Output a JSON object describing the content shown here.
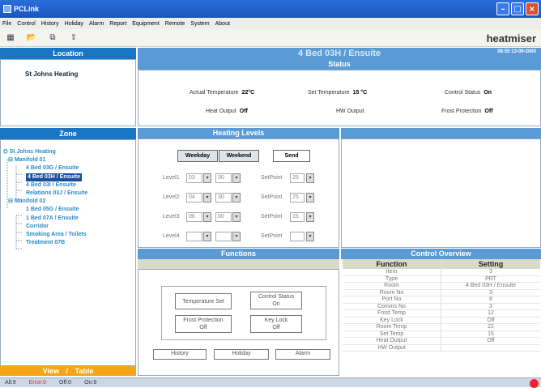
{
  "window": {
    "title": "PCLink"
  },
  "menu": [
    "File",
    "Control",
    "History",
    "Holiday",
    "Alarm",
    "Report",
    "Equipment",
    "Remote",
    "System",
    "About"
  ],
  "logo": "heatmiser",
  "location": {
    "header": "Location",
    "item": "St Johns Heating"
  },
  "zone": {
    "header": "Zone",
    "tree": [
      {
        "label": "St Johns Heating",
        "level": 0
      },
      {
        "label": "Manifold 01",
        "level": 1
      },
      {
        "label": "4 Bed 03G / Ensuite",
        "level": 2
      },
      {
        "label": "4 Bed 03H / Ensuite",
        "level": 2,
        "selected": true
      },
      {
        "label": "4 Bed 03I / Ensuite",
        "level": 2
      },
      {
        "label": "Relations 03J / Ensuite",
        "level": 2
      },
      {
        "label": "Manifold 02",
        "level": 1
      },
      {
        "label": "1 Bed 05G / Ensuite",
        "level": 2
      },
      {
        "label": "1 Bed 07A / Ensuite",
        "level": 2
      },
      {
        "label": "Corridor",
        "level": 2
      },
      {
        "label": "Smoking Area / Toilets",
        "level": 2
      },
      {
        "label": "Treatment 07B",
        "level": 2
      }
    ]
  },
  "viewtab": {
    "view": "View",
    "sep": "/",
    "table": "Table"
  },
  "main": {
    "room_title": "4 Bed 03H / Ensuite",
    "datetime": "08:55 13-09-2005",
    "status_header": "Status"
  },
  "status": {
    "actual_temp_label": "Actual Temperature",
    "actual_temp_value": "22°C",
    "set_temp_label": "Set Temperature",
    "set_temp_value": "15 °C",
    "control_status_label": "Control Status",
    "control_status_value": "On",
    "heat_output_label": "Heat Output",
    "heat_output_value": "Off",
    "hw_output_label": "HW Output",
    "hw_output_value": "",
    "frost_label": "Frost Protection",
    "frost_value": "Off"
  },
  "heating": {
    "header": "Heating Levels",
    "weekday": "Weekday",
    "weekend": "Weekend",
    "send": "Send",
    "levels": [
      {
        "label": "Level1",
        "hour": "03",
        "min": "30",
        "setpoint_label": "SetPoint",
        "setpoint": "25"
      },
      {
        "label": "Level2",
        "hour": "04",
        "min": "30",
        "setpoint_label": "SetPoint",
        "setpoint": "25"
      },
      {
        "label": "Level3",
        "hour": "06",
        "min": "00",
        "setpoint_label": "SetPoint",
        "setpoint": "15"
      },
      {
        "label": "Level4",
        "hour": "",
        "min": "",
        "setpoint_label": "SetPoint",
        "setpoint": ""
      }
    ]
  },
  "functions": {
    "header": "Functions",
    "temp_set": "Temperature Set",
    "control_status_l1": "Control Status",
    "control_status_l2": "On",
    "frost_l1": "Frost Protection",
    "frost_l2": "Off",
    "keylock_l1": "Key Lock",
    "keylock_l2": "Off",
    "history": "History",
    "holiday": "Holiday",
    "alarm": "Alarm"
  },
  "overview": {
    "header": "Control Overview",
    "col_function": "Function",
    "col_setting": "Setting",
    "rows": [
      [
        "Item",
        "3"
      ],
      [
        "Type",
        "PRT"
      ],
      [
        "Room",
        "4 Bed 03H / Ensuite"
      ],
      [
        "Room No",
        "3"
      ],
      [
        "Port No",
        "8"
      ],
      [
        "Comms No",
        "3"
      ],
      [
        "Frost Temp",
        "12"
      ],
      [
        "Key Lock",
        "Off"
      ],
      [
        "Room Temp",
        "22"
      ],
      [
        "Set Temp",
        "15"
      ],
      [
        "Heat Output",
        "Off"
      ],
      [
        "HW Output",
        ""
      ]
    ]
  },
  "statusbar": {
    "all": "All:9",
    "error": "Error:0",
    "off": "Off:0",
    "on": "On:9"
  }
}
